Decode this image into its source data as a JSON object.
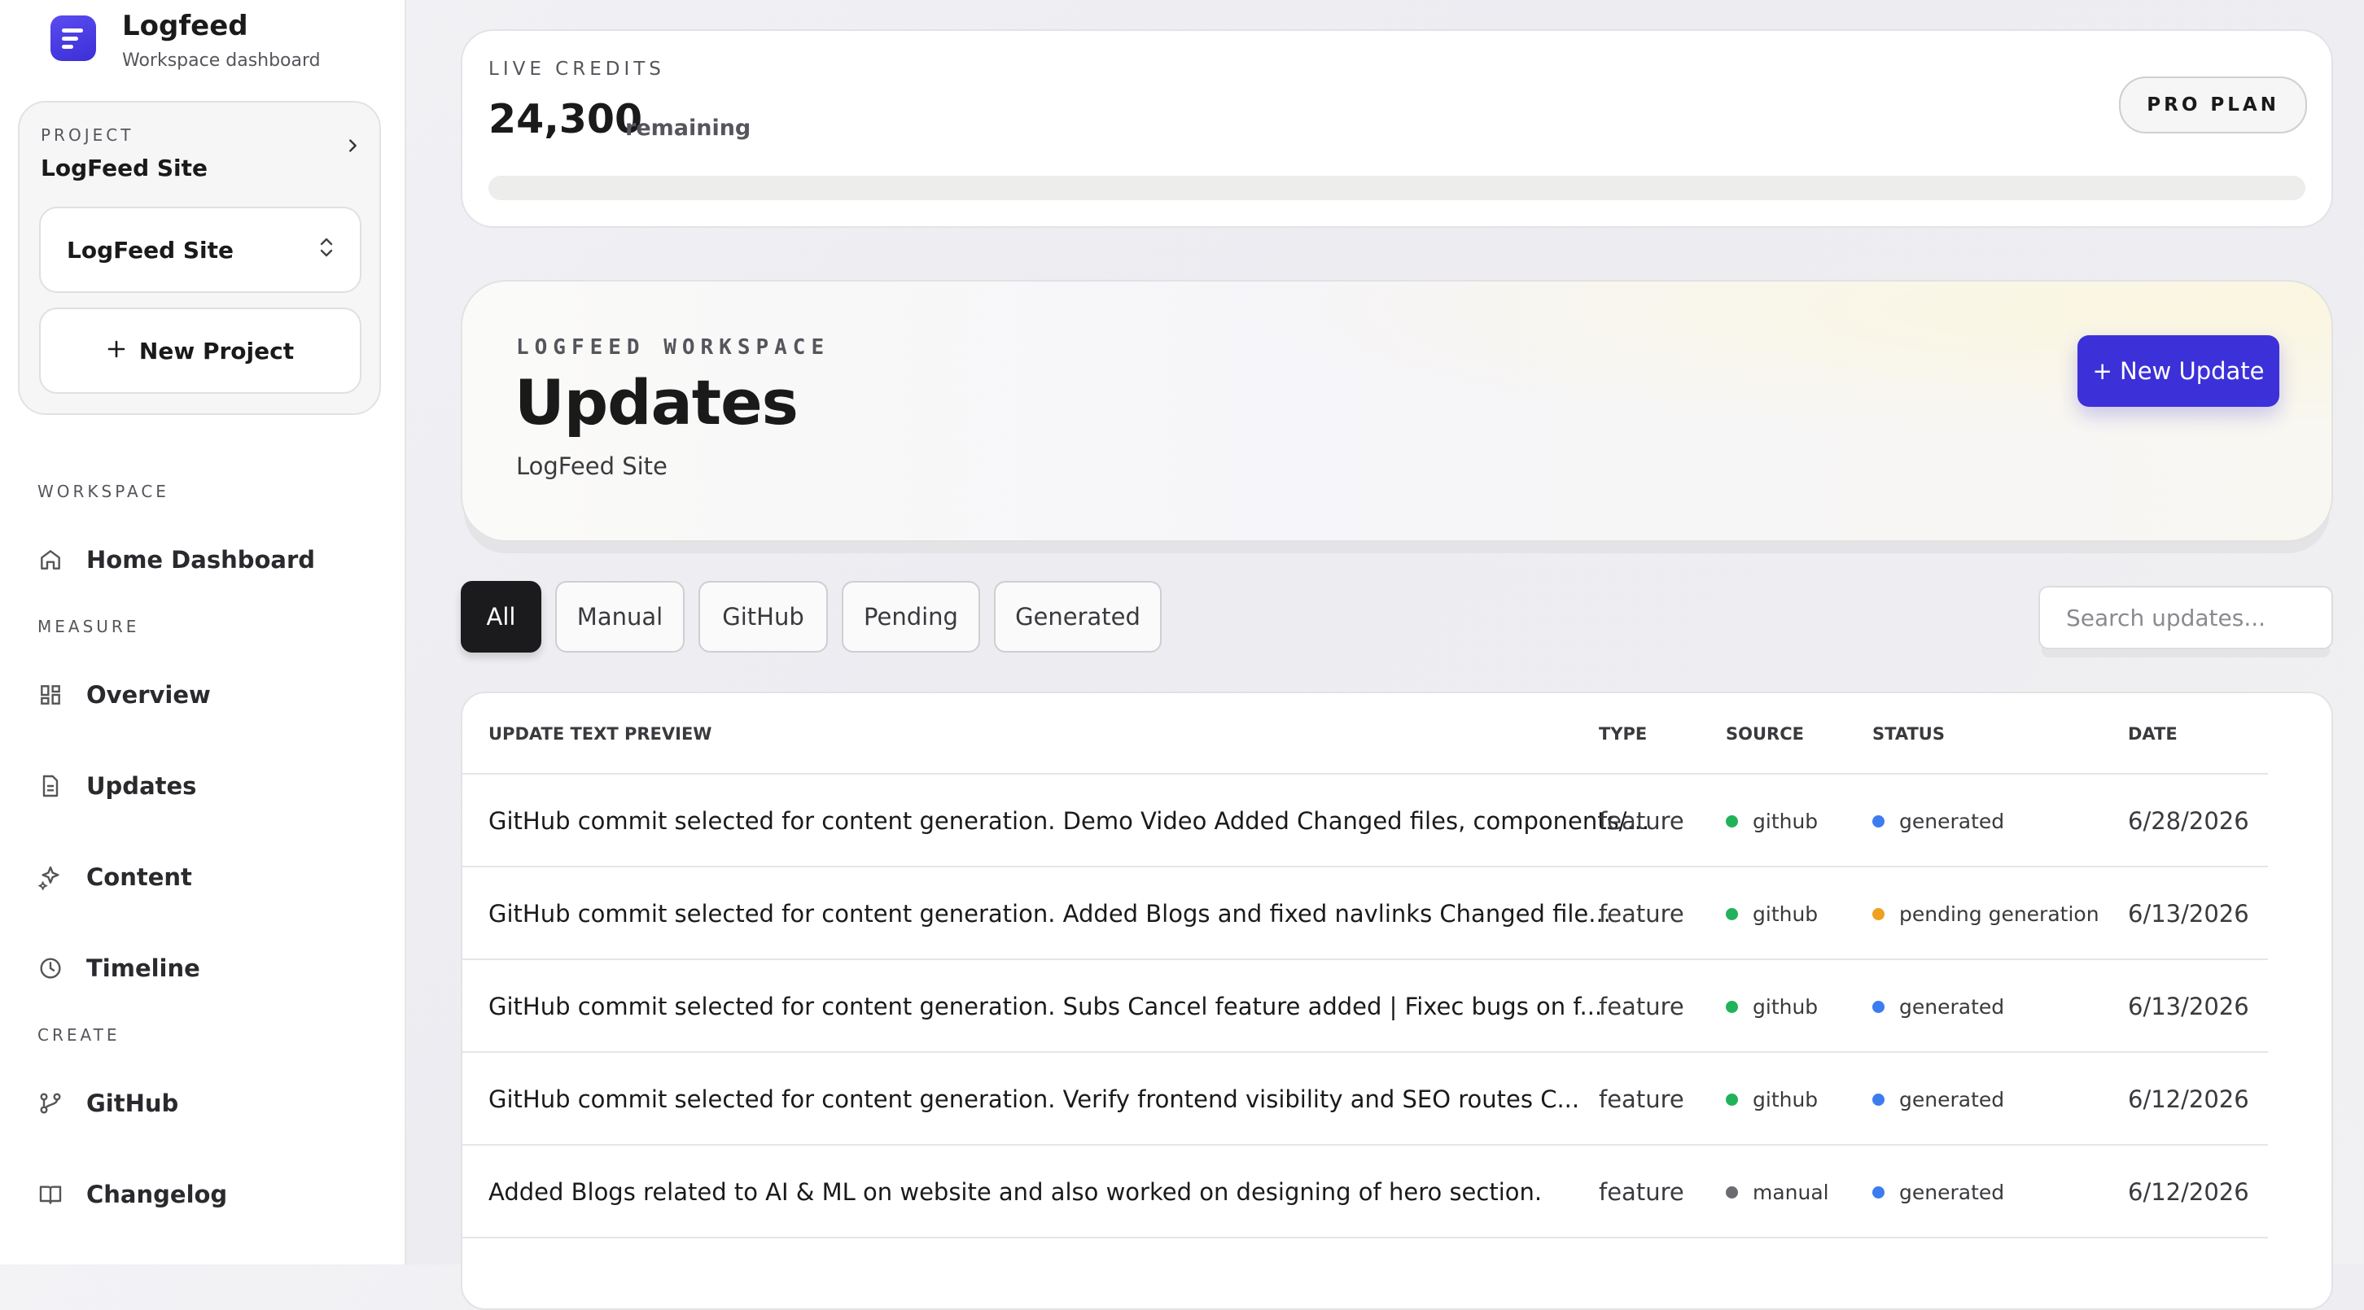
{
  "brand": {
    "name": "Logfeed",
    "subtitle": "Workspace dashboard"
  },
  "project": {
    "kicker": "PROJECT",
    "name": "LogFeed Site",
    "selector_value": "LogFeed Site",
    "new_project_label": "New Project"
  },
  "nav": {
    "workspace_label": "WORKSPACE",
    "measure_label": "MEASURE",
    "create_label": "CREATE",
    "home": "Home Dashboard",
    "overview": "Overview",
    "updates": "Updates",
    "content": "Content",
    "timeline": "Timeline",
    "github": "GitHub",
    "changelog": "Changelog"
  },
  "credits": {
    "kicker": "LIVE CREDITS",
    "value": "24,300",
    "unit": "remaining",
    "plan": "PRO PLAN"
  },
  "hero": {
    "kicker": "LOGFEED WORKSPACE",
    "title": "Updates",
    "subtitle": "LogFeed Site",
    "new_update_label": "+ New Update"
  },
  "filters": [
    "All",
    "Manual",
    "GitHub",
    "Pending",
    "Generated"
  ],
  "search": {
    "placeholder": "Search updates..."
  },
  "table": {
    "headers": {
      "preview": "UPDATE TEXT PREVIEW",
      "type": "TYPE",
      "source": "SOURCE",
      "status": "STATUS",
      "date": "DATE"
    },
    "rows": [
      {
        "text": "GitHub commit selected for content generation. Demo Video Added Changed files, components/...",
        "type": "feature",
        "source": "github",
        "status": "generated",
        "date": "6/28/2026"
      },
      {
        "text": "GitHub commit selected for content generation. Added Blogs and fixed navlinks Changed file...",
        "type": "feature",
        "source": "github",
        "status": "pending generation",
        "date": "6/13/2026"
      },
      {
        "text": "GitHub commit selected for content generation. Subs Cancel feature added | Fixec bugs on f...",
        "type": "feature",
        "source": "github",
        "status": "generated",
        "date": "6/13/2026"
      },
      {
        "text": "GitHub commit selected for content generation. Verify frontend visibility and SEO routes C...",
        "type": "feature",
        "source": "github",
        "status": "generated",
        "date": "6/12/2026"
      },
      {
        "text": "Added Blogs related to AI & ML on website and also worked on designing of hero section.",
        "type": "feature",
        "source": "manual",
        "status": "generated",
        "date": "6/12/2026"
      }
    ]
  },
  "colors": {
    "accent": "#3c31d8",
    "source_github": "#22b25a",
    "source_manual": "#6b6b70",
    "status_generated": "#3b7cf0",
    "status_pending": "#f0a020"
  }
}
